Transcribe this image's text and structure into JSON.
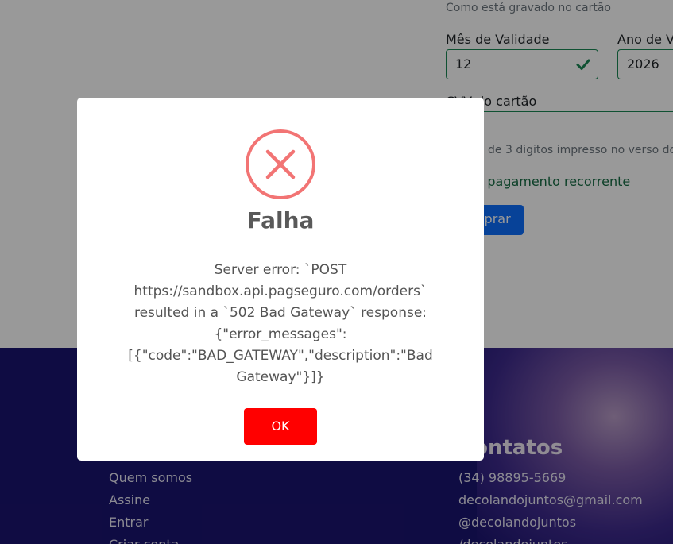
{
  "form": {
    "cardholder_hint": "Como está gravado no cartão",
    "expiry_month_label": "Mês de Validade",
    "expiry_month_value": "12",
    "expiry_year_label": "Ano de V",
    "expiry_year_value": "2026",
    "cvv_label": "CVV do cartão",
    "cvv_hint": "Código de 3 digitos impresso no verso do",
    "recurring_label": "Ativar pagamento recorrente",
    "buy_button": "Comprar",
    "valid_color": "#198754"
  },
  "footer": {
    "contacts_heading": "Contatos",
    "nav_links": [
      "Quem somos",
      "Assine",
      "Entrar",
      "Criar conta"
    ],
    "contact_items": [
      "(34) 98895-5669",
      "decolandojuntos@gmail.com",
      "@decolandojuntos",
      "/decolandojuntos"
    ]
  },
  "dialog": {
    "icon": "error-x-icon",
    "title": "Falha",
    "message": "Server error: `POST https://sandbox.api.pagseguro.com/orders` resulted in a `502 Bad Gateway` response: {\"error_messages\":[{\"code\":\"BAD_GATEWAY\",\"description\":\"Bad Gateway\"}]}",
    "ok_button": "OK",
    "error_color": "#f27474",
    "ok_color": "#ff0000"
  }
}
